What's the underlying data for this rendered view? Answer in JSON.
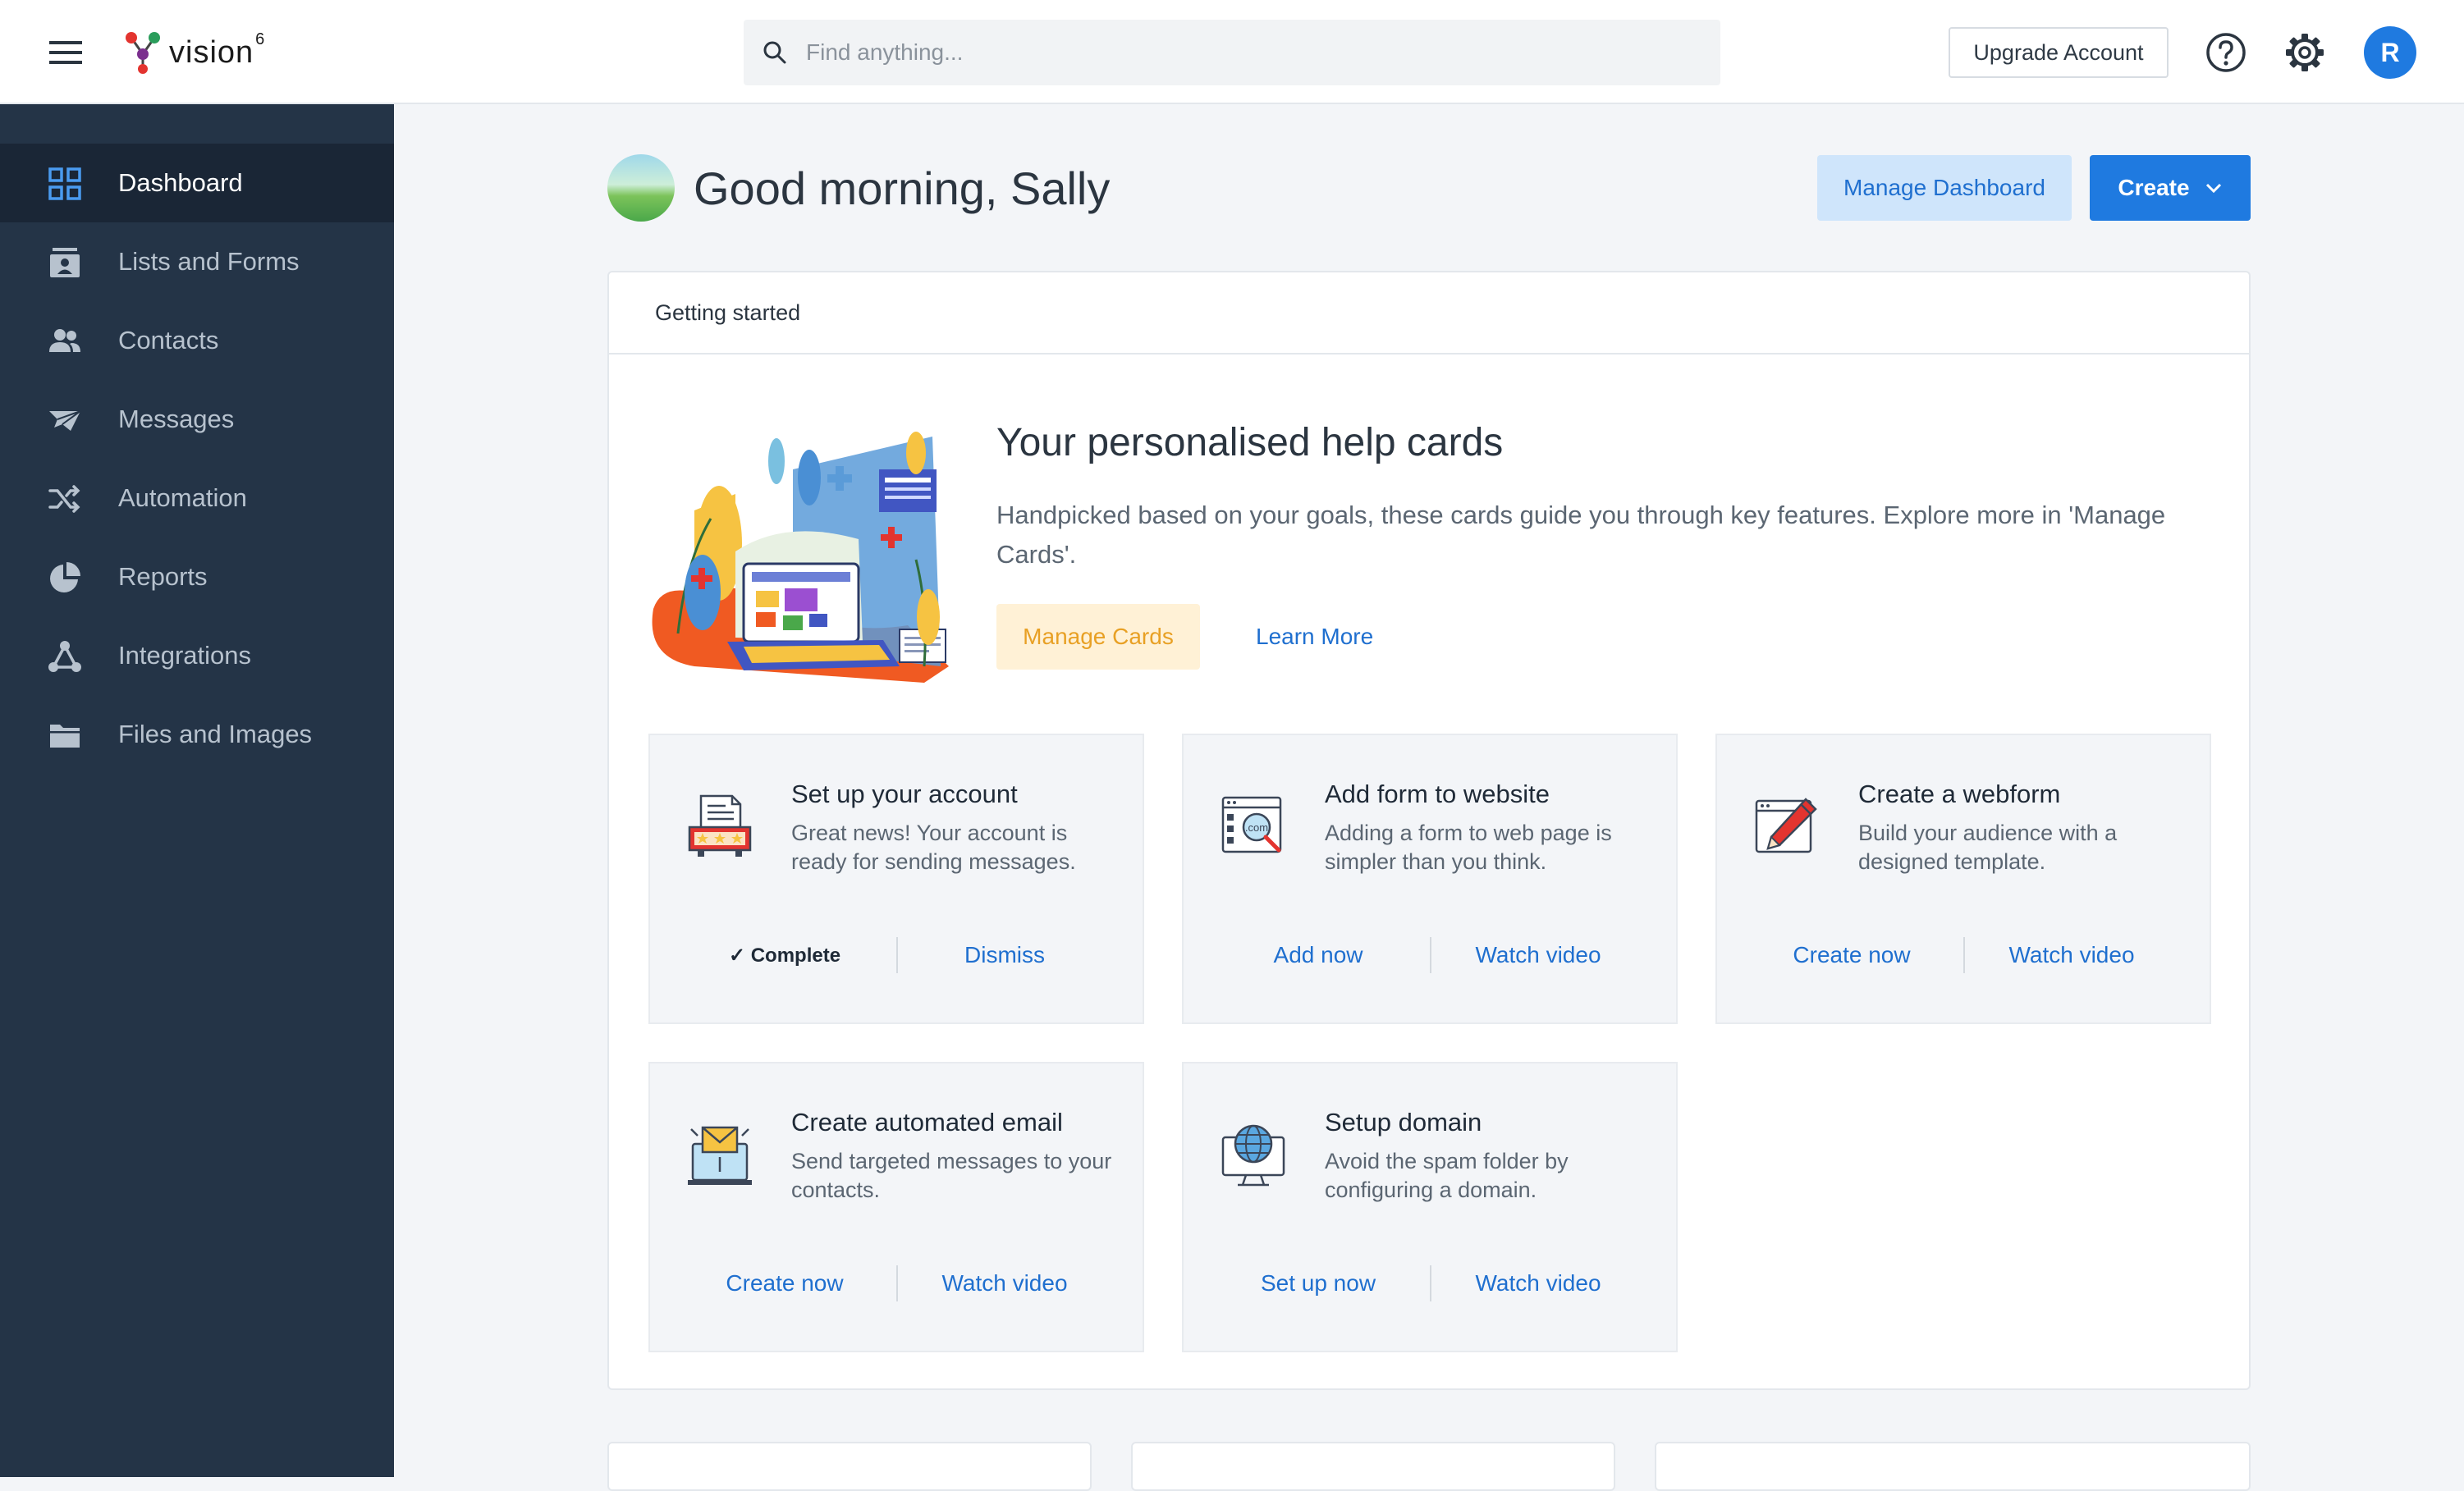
{
  "app": {
    "logo_text": "vision",
    "logo_sup": "6",
    "search_placeholder": "Find anything...",
    "upgrade_label": "Upgrade Account",
    "avatar_initial": "R",
    "accent": "#1f7ae0"
  },
  "sidebar": {
    "items": [
      {
        "label": "Dashboard",
        "icon": "dashboard-icon",
        "active": true
      },
      {
        "label": "Lists and Forms",
        "icon": "lists-icon"
      },
      {
        "label": "Contacts",
        "icon": "contacts-icon"
      },
      {
        "label": "Messages",
        "icon": "messages-icon"
      },
      {
        "label": "Automation",
        "icon": "automation-icon"
      },
      {
        "label": "Reports",
        "icon": "reports-icon"
      },
      {
        "label": "Integrations",
        "icon": "integrations-icon"
      },
      {
        "label": "Files and Images",
        "icon": "folder-icon"
      }
    ]
  },
  "header": {
    "greeting": "Good morning, Sally",
    "manage_dashboard": "Manage Dashboard",
    "create": "Create"
  },
  "getting_started": {
    "title": "Getting started",
    "hero_title": "Your personalised help cards",
    "hero_desc": "Handpicked based on your goals, these cards guide you through key features. Explore more in 'Manage Cards'.",
    "manage_cards": "Manage Cards",
    "learn_more": "Learn More"
  },
  "cards": [
    {
      "title": "Set up your account",
      "desc": "Great news! Your account is ready for sending messages.",
      "icon": "account-setup-icon",
      "status": "✓ Complete",
      "action": "Dismiss"
    },
    {
      "title": "Add form to website",
      "desc": "Adding a form to web page is simpler than you think.",
      "icon": "website-form-icon",
      "action": "Add now",
      "secondary": "Watch video"
    },
    {
      "title": "Create a webform",
      "desc": "Build your audience with a designed template.",
      "icon": "webform-icon",
      "action": "Create now",
      "secondary": "Watch video"
    },
    {
      "title": "Create automated email",
      "desc": "Send targeted messages to your contacts.",
      "icon": "automated-email-icon",
      "action": "Create now",
      "secondary": "Watch video"
    },
    {
      "title": "Setup domain",
      "desc": "Avoid the spam folder by configuring a domain.",
      "icon": "domain-icon",
      "action": "Set up now",
      "secondary": "Watch video"
    }
  ]
}
